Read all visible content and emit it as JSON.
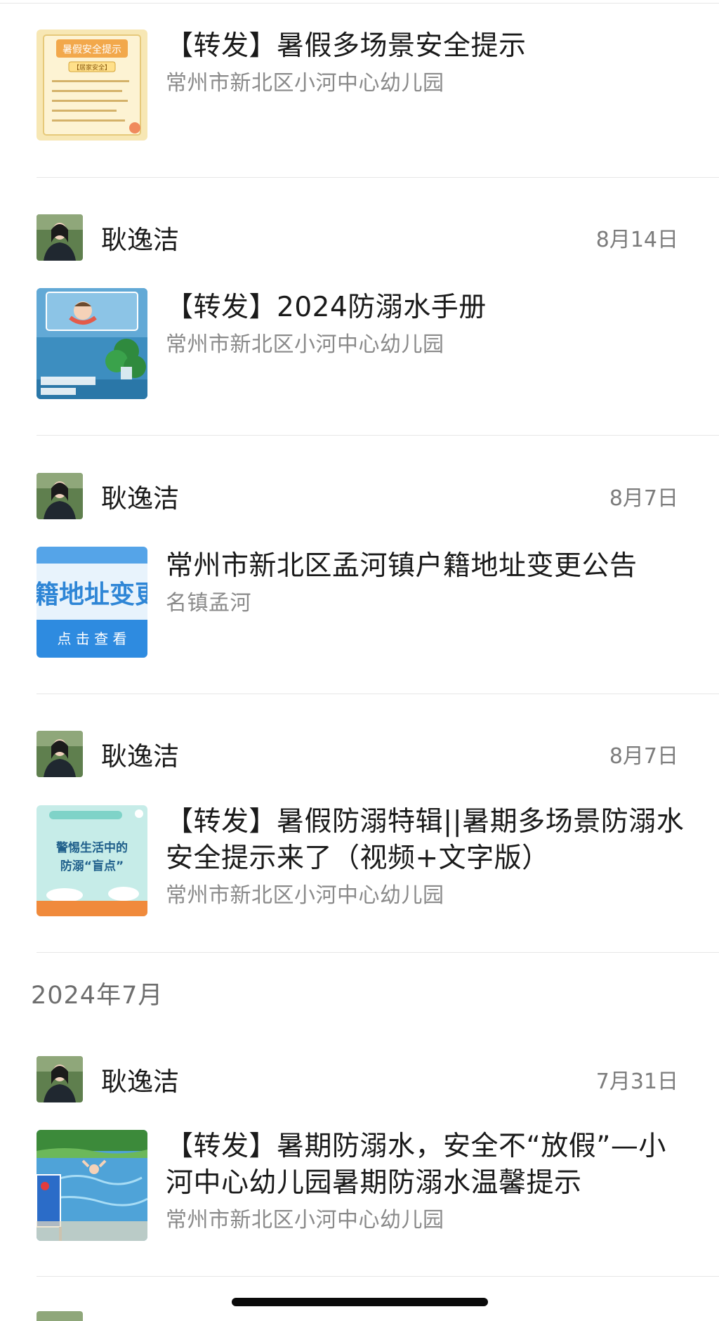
{
  "feed": {
    "month_label": "2024年7月",
    "items": [
      {
        "sender": "",
        "date": "",
        "title": "【转发】暑假多场景安全提示",
        "source": "常州市新北区小河中心幼儿园",
        "thumb_label": "暑假安全提示",
        "thumb_sub": "【居家安全】"
      },
      {
        "sender": "耿逸洁",
        "date": "8月14日",
        "title": "【转发】2024防溺水手册",
        "source": "常州市新北区小河中心幼儿园",
        "thumb_label": "",
        "thumb_sub": ""
      },
      {
        "sender": "耿逸洁",
        "date": "8月7日",
        "title": "常州市新北区孟河镇户籍地址变更公告",
        "source": "名镇孟河",
        "thumb_label": "籍地址变更公",
        "thumb_sub": "点 击 查 看"
      },
      {
        "sender": "耿逸洁",
        "date": "8月7日",
        "title": "【转发】暑假防溺特辑||暑期多场景防溺水安全提示来了（视频+文字版）",
        "source": "常州市新北区小河中心幼儿园",
        "thumb_label": "警惕生活中的",
        "thumb_sub": "防溺“盲点”"
      },
      {
        "sender": "耿逸洁",
        "date": "7月31日",
        "title": "【转发】暑期防溺水，安全不“放假”—小河中心幼儿园暑期防溺水温馨提示",
        "source": "常州市新北区小河中心幼儿园",
        "thumb_label": "",
        "thumb_sub": ""
      }
    ]
  },
  "colors": {
    "text_primary": "#1a1a1a",
    "text_secondary": "#8a8a8a",
    "date": "#7c7c7c",
    "divider": "#e6e6e6"
  }
}
